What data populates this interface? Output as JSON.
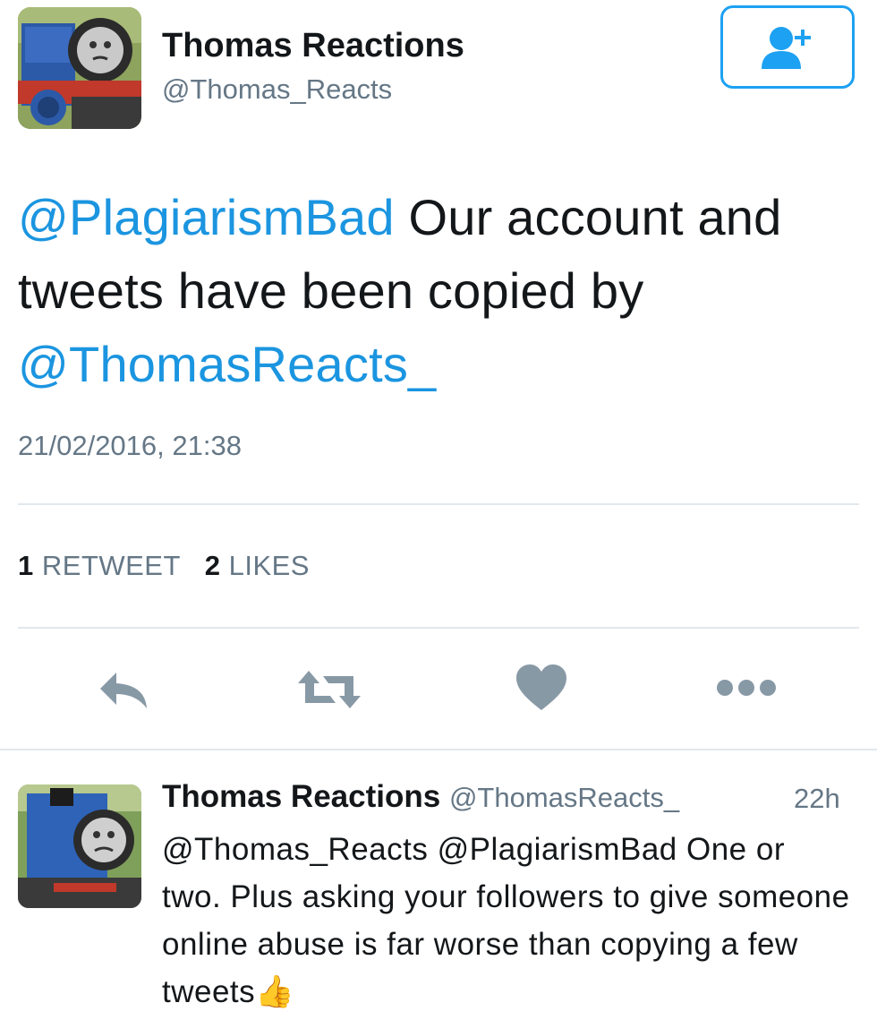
{
  "tweet": {
    "author": {
      "name": "Thomas Reactions",
      "handle": "@Thomas_Reacts",
      "avatar_icon": "train-avatar"
    },
    "follow_button_icon": "follow-user-plus-icon",
    "text": {
      "mention_1": "@PlagiarismBad",
      "body_1": " Our account and tweets have been copied by ",
      "mention_2": "@ThomasReacts_"
    },
    "timestamp": "21/02/2016, 21:38",
    "stats": {
      "retweet_count": "1",
      "retweet_label": "RETWEET",
      "like_count": "2",
      "like_label": "LIKES"
    },
    "actions": [
      {
        "name": "reply",
        "icon": "reply-icon"
      },
      {
        "name": "retweet",
        "icon": "retweet-icon"
      },
      {
        "name": "like",
        "icon": "heart-icon"
      },
      {
        "name": "more",
        "icon": "more-icon"
      }
    ]
  },
  "reply": {
    "author_name": "Thomas Reactions",
    "author_handle": "@ThomasReacts_",
    "time": "22h",
    "text": "@Thomas_Reacts @PlagiarismBad One or two. Plus asking your followers to give someone online abuse is far worse than copying a few tweets",
    "emoji": "👍"
  },
  "colors": {
    "accent": "#1da1f2",
    "mention": "#1b95e0",
    "muted": "#657786",
    "icon": "#8899a6",
    "divider": "#e1e8ed"
  }
}
